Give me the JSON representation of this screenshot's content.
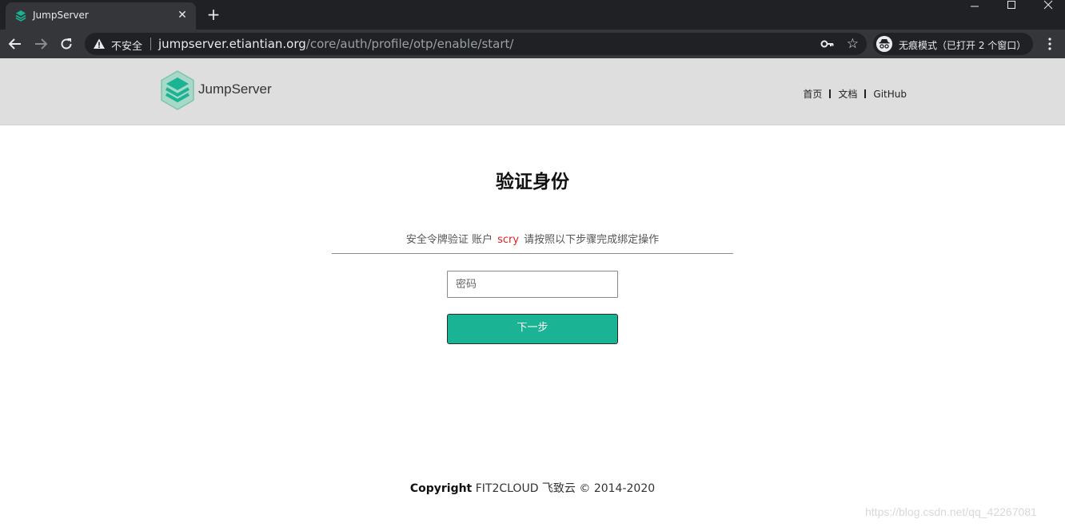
{
  "browser": {
    "tab_title": "JumpServer",
    "tab_close": "✕",
    "new_tab": "+",
    "insecure_label": "不安全",
    "url_host": "jumpserver.etiantian.org",
    "url_path": "/core/auth/profile/otp/enable/start/",
    "incognito_label": "无痕模式（已打开 2 个窗口）",
    "accent": "#35363a"
  },
  "header": {
    "brand": "JumpServer",
    "links": [
      "首页",
      "文档",
      "GitHub"
    ],
    "logo_color": "#1ab394"
  },
  "main": {
    "title": "验证身份",
    "subtitle_prefix": "安全令牌验证  账户",
    "username": "scry",
    "subtitle_suffix": "请按照以下步骤完成绑定操作",
    "password_placeholder": "密码",
    "next_label": "下一步",
    "button_color": "#1ab394"
  },
  "footer": {
    "copyright_label": "Copyright",
    "copyright_text": "FIT2CLOUD 飞致云 © 2014-2020"
  },
  "watermark": "https://blog.csdn.net/qq_42267081"
}
